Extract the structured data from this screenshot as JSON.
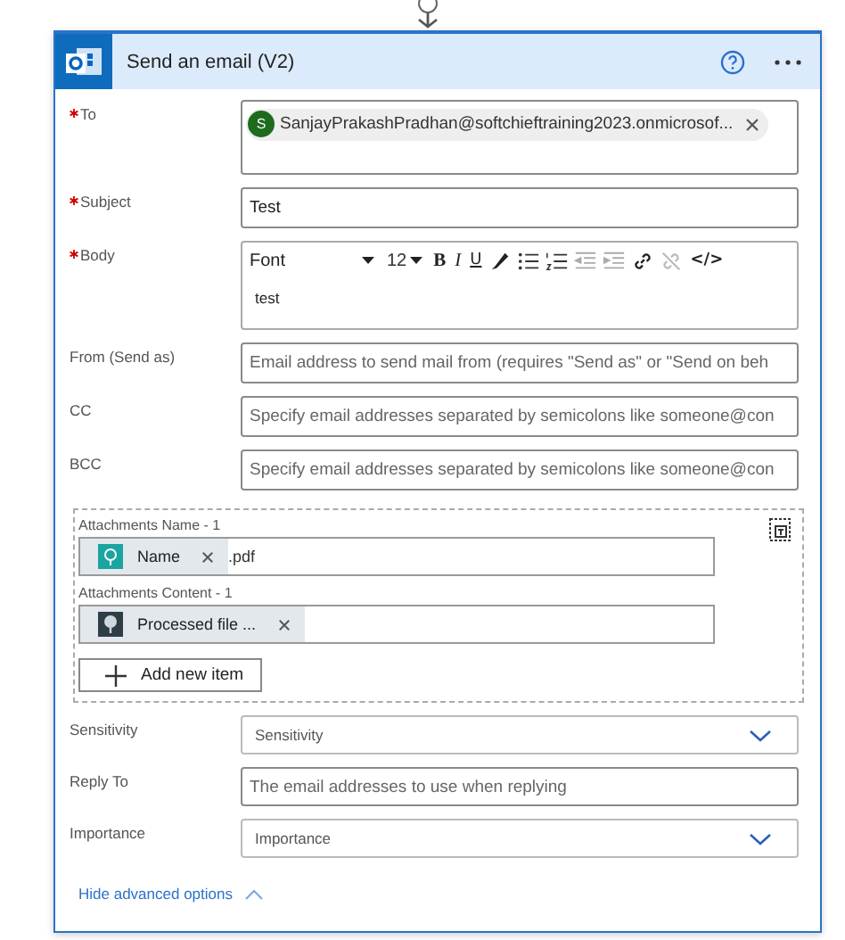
{
  "action": {
    "title": "Send an email (V2)"
  },
  "fields": [
    {
      "kind": "recipients",
      "label": "To",
      "required": true,
      "tokens": [
        {
          "initial": "S",
          "text": "SanjayPrakashPradhan@softchieftraining2023.onmicrosof..."
        }
      ]
    },
    {
      "kind": "text",
      "label": "Subject",
      "required": true,
      "value": "Test"
    },
    {
      "kind": "richtext",
      "label": "Body",
      "required": true,
      "font": "Font",
      "size": "12",
      "format_buttons": [
        "B",
        "I",
        "U"
      ],
      "code_button": "</>",
      "value": "test"
    },
    {
      "kind": "text",
      "label": "From (Send as)",
      "required": false,
      "placeholder": "Email address to send mail from (requires \"Send as\" or \"Send on beh"
    },
    {
      "kind": "text",
      "label": "CC",
      "required": false,
      "placeholder": "Specify email addresses separated by semicolons like someone@con"
    },
    {
      "kind": "text",
      "label": "BCC",
      "required": false,
      "placeholder": "Specify email addresses separated by semicolons like someone@con"
    }
  ],
  "attachments": {
    "items": [
      {
        "label": "Attachments Name - 1",
        "tokens": [
          {
            "kind": "trigger",
            "text": "Name"
          }
        ],
        "suffix": ".pdf"
      },
      {
        "label": "Attachments Content - 1",
        "tokens": [
          {
            "kind": "tree",
            "text": "Processed file ..."
          }
        ]
      }
    ],
    "add_button": "Add new item"
  },
  "options": [
    {
      "kind": "dropdown",
      "label": "Sensitivity",
      "placeholder": "Sensitivity"
    },
    {
      "kind": "text",
      "label": "Reply To",
      "placeholder": "The email addresses to use when replying"
    },
    {
      "kind": "dropdown",
      "label": "Importance",
      "placeholder": "Importance"
    }
  ],
  "toggle": {
    "label": "Hide advanced options",
    "expanded": true
  }
}
